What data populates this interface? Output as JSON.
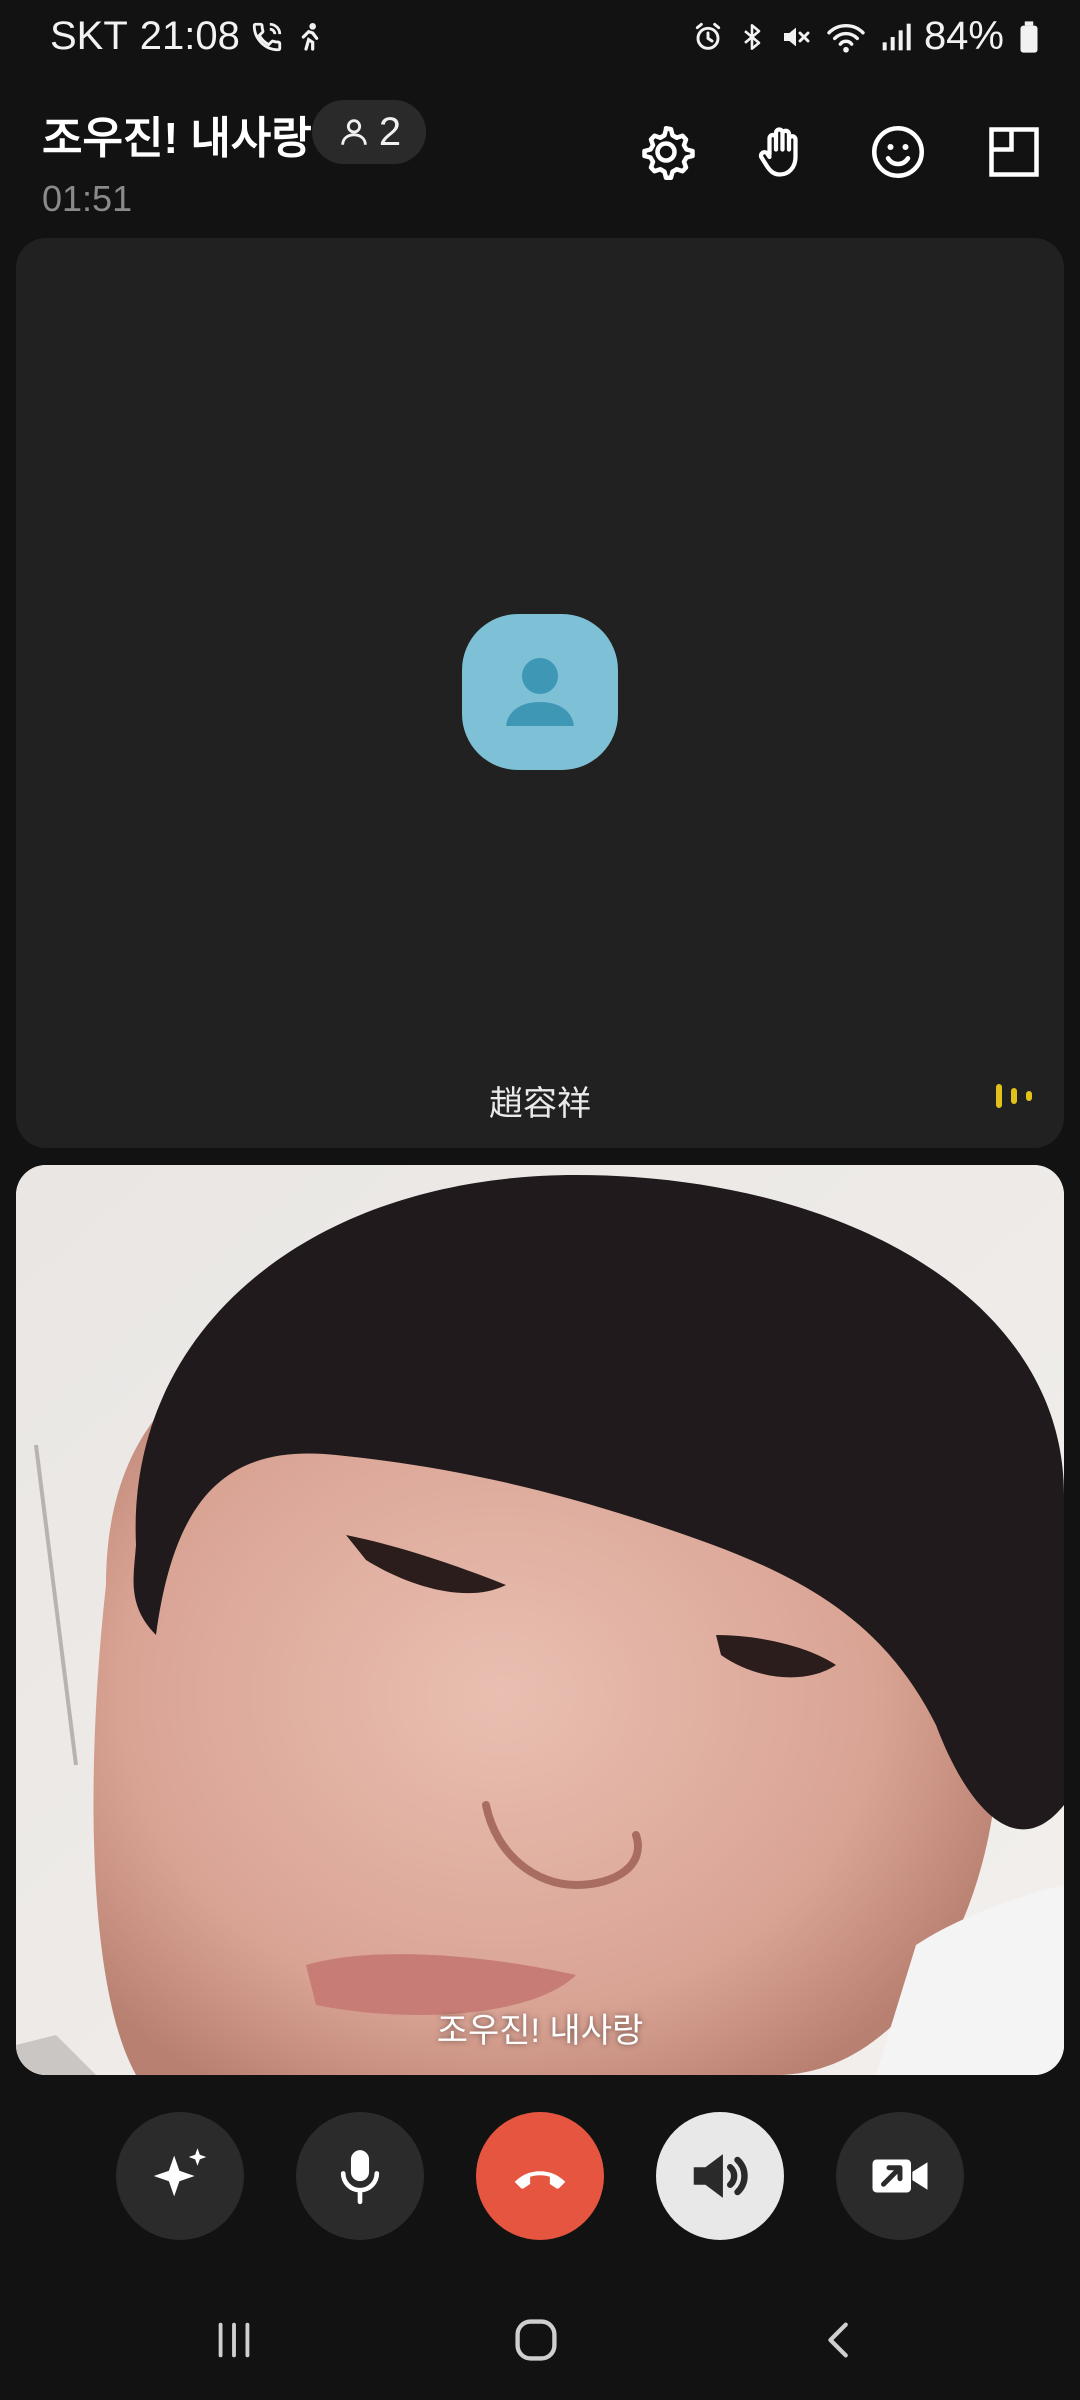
{
  "status_bar": {
    "carrier": "SKT",
    "time": "21:08",
    "battery": "84%"
  },
  "call": {
    "title": "조우진! 내사랑",
    "participant_count": "2",
    "elapsed": "01:51"
  },
  "header_actions": [
    {
      "icon": "gear-icon"
    },
    {
      "icon": "raise-hand-icon"
    },
    {
      "icon": "emoji-icon"
    },
    {
      "icon": "layout-icon"
    }
  ],
  "remote": {
    "name": "趙容祥",
    "avatar_color": "#7ec0d6",
    "speaking_color": "#e0c21a"
  },
  "local": {
    "name": "조우진! 내사랑"
  },
  "controls": [
    {
      "icon": "sparkle-effects-icon"
    },
    {
      "icon": "microphone-icon"
    },
    {
      "icon": "end-call-icon",
      "color": "#e5553f"
    },
    {
      "icon": "speaker-icon",
      "active": true
    },
    {
      "icon": "video-off-icon"
    }
  ],
  "nav": [
    {
      "icon": "recent-apps-icon"
    },
    {
      "icon": "home-icon"
    },
    {
      "icon": "back-icon"
    }
  ]
}
